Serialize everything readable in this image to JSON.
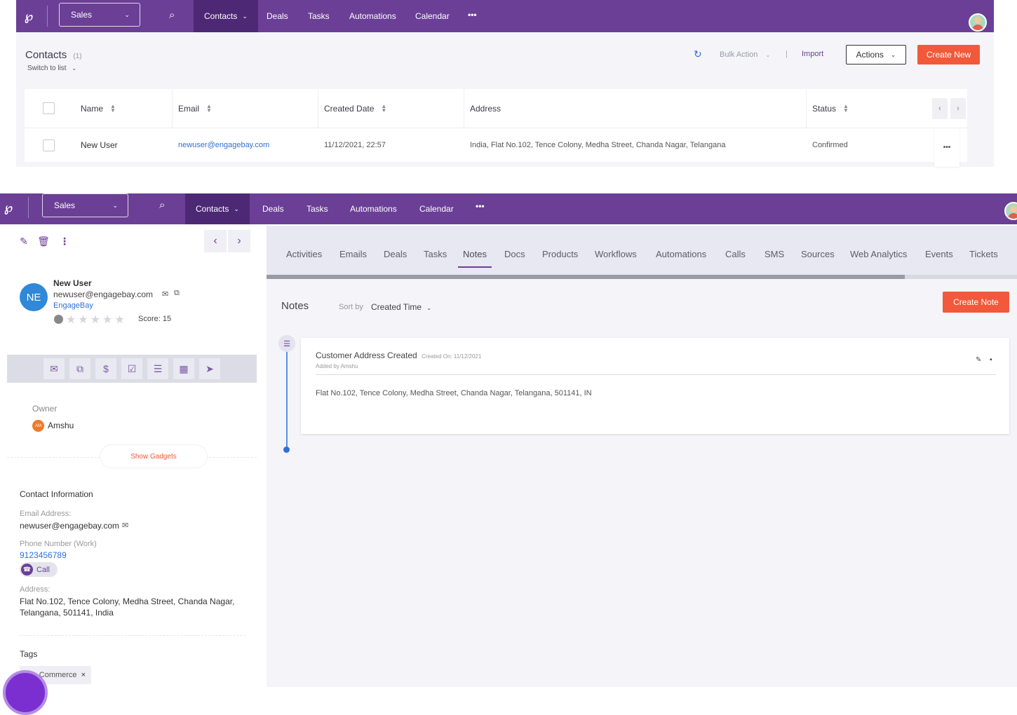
{
  "nav": {
    "pipeline": "Sales",
    "items": [
      "Contacts",
      "Deals",
      "Tasks",
      "Automations",
      "Calendar"
    ],
    "more": "•••"
  },
  "contacts": {
    "title": "Contacts",
    "count": "(1)",
    "switch_label": "Switch to list",
    "bulk_action": "Bulk Action",
    "import": "Import",
    "actions": "Actions",
    "create_new": "Create New",
    "columns": [
      "Name",
      "Email",
      "Created Date",
      "Address",
      "Status"
    ],
    "row": {
      "name": "New User",
      "email": "newuser@engagebay.com",
      "created": "11/12/2021, 22:57",
      "address": "India, Flat No.102, Tence Colony, Medha Street, Chanda Nagar, Telangana",
      "status": "Confirmed"
    },
    "row_more": "•••"
  },
  "profile": {
    "initials": "NE",
    "name": "New User",
    "email": "newuser@engagebay.com",
    "company": "EngageBay",
    "rating": 0,
    "score_label": "Score: 15",
    "owner_label": "Owner",
    "owner_initials": "AM",
    "owner_name": "Amshu",
    "show_gadgets": "Show Gadgets",
    "contact_info_title": "Contact Information",
    "email_label": "Email Address:",
    "email_value": "newuser@engagebay.com",
    "phone_label": "Phone Number (Work)",
    "phone_value": "9123456789",
    "call_label": "Call",
    "address_label": "Address:",
    "address_line1": "Flat No.102, Tence Colony, Medha Street, Chanda Nagar,",
    "address_line2": "Telangana, 501141, India",
    "tags_title": "Tags",
    "tag": "Commerce"
  },
  "tabs": [
    "Activities",
    "Emails",
    "Deals",
    "Tasks",
    "Notes",
    "Docs",
    "Products",
    "Workflows",
    "Automations",
    "Calls",
    "SMS",
    "Sources",
    "Web Analytics",
    "Events",
    "Tickets"
  ],
  "active_tab": "Notes",
  "notes": {
    "title": "Notes",
    "sort_by": "Sort by",
    "sort_value": "Created Time",
    "create_note": "Create Note",
    "note": {
      "title": "Customer Address Created",
      "created_on": "Created On: 11/12/2021",
      "added_by": "Added by Amshu",
      "body": "Flat No.102, Tence Colony, Medha Street, Chanda Nagar, Telangana, 501141, IN"
    }
  },
  "colors": {
    "nav": "#6b3f96",
    "nav_active": "#4d2874",
    "accent": "#f1593a",
    "link": "#2f6fd8"
  }
}
